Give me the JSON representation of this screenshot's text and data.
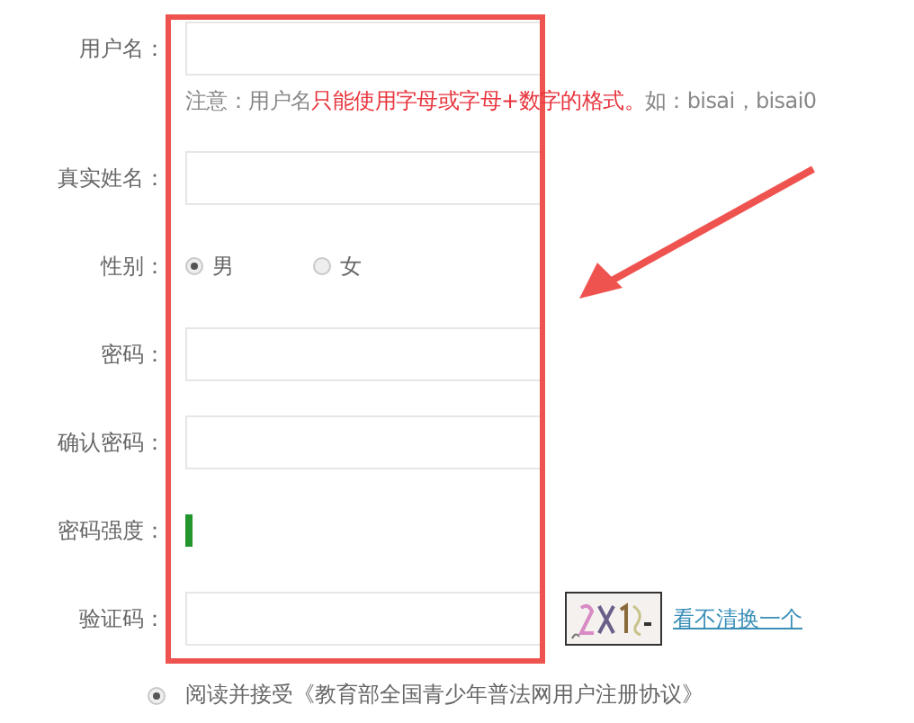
{
  "form": {
    "rows": [
      {
        "kind": "text",
        "label": "用户名：",
        "hint": [
          {
            "text": "注意：用户名",
            "emphasis": false
          },
          {
            "text": "只能使用字母或字母+数字的格式。",
            "emphasis": true
          },
          {
            "text": "如：bisai，bisai0",
            "emphasis": false
          }
        ]
      },
      {
        "kind": "text",
        "label": "真实姓名："
      },
      {
        "kind": "radio",
        "label": "性别：",
        "options": [
          {
            "label": "男",
            "selected": true
          },
          {
            "label": "女",
            "selected": false
          }
        ]
      },
      {
        "kind": "text",
        "label": "密码："
      },
      {
        "kind": "text",
        "label": "确认密码："
      },
      {
        "kind": "meter",
        "label": "密码强度："
      },
      {
        "kind": "captcha",
        "label": "验证码：",
        "link": "看不清换一个"
      }
    ]
  },
  "agreement": {
    "selected": true,
    "text": "阅读并接受《教育部全国青少年普法网用户注册协议》"
  }
}
